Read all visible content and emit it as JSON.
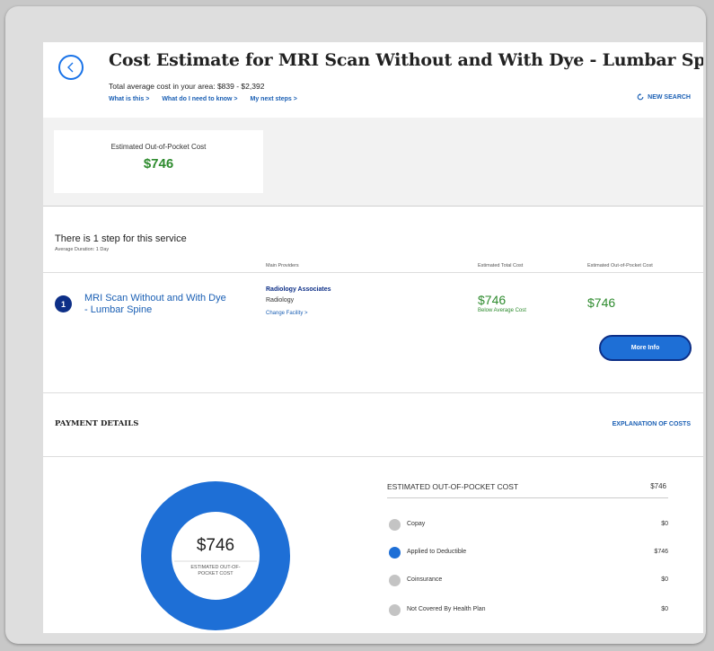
{
  "header": {
    "title": "Cost Estimate for MRI Scan Without and With Dye - Lumbar Spine",
    "avg_cost": "Total average cost in your area: $839 - $2,392",
    "links": [
      "What is this >",
      "What do I need to know >",
      "My next steps >"
    ],
    "new_search": "NEW SEARCH"
  },
  "summary": {
    "label": "Estimated Out-of-Pocket Cost",
    "value": "$746"
  },
  "steps": {
    "heading": "There is 1 step for this service",
    "duration": "Average Duration: 1 Day",
    "columns": {
      "providers": "Main Providers",
      "total": "Estimated Total Cost",
      "oop": "Estimated Out-of-Pocket Cost"
    },
    "items": [
      {
        "number": "1",
        "name": "MRI Scan Without and With Dye - Lumbar Spine",
        "provider": "Radiology Associates",
        "specialty": "Radiology",
        "change_facility": "Change Facility >",
        "total_cost": "$746",
        "total_note": "Below Average Cost",
        "oop_cost": "$746",
        "more_info": "More Info"
      }
    ]
  },
  "payment": {
    "title": "PAYMENT DETAILS",
    "explanation_link": "EXPLANATION OF COSTS",
    "donut_value": "$746",
    "donut_label_1": "ESTIMATED OUT-OF-",
    "donut_label_2": "POCKET COST",
    "breakdown_header": "ESTIMATED OUT-OF-POCKET COST",
    "breakdown_total": "$746",
    "rows": [
      {
        "label": "Copay",
        "value": "$0",
        "color": "#c4c4c4"
      },
      {
        "label": "Applied to Deductible",
        "value": "$746",
        "color": "#1e6fd6"
      },
      {
        "label": "Coinsurance",
        "value": "$0",
        "color": "#c4c4c4"
      },
      {
        "label": "Not Covered By Health Plan",
        "value": "$0",
        "color": "#c4c4c4"
      }
    ]
  },
  "colors": {
    "accent_blue": "#1e6fd6",
    "navy": "#0d2f87",
    "cost_green": "#2e8b2e",
    "link_blue": "#1a5fb4"
  }
}
